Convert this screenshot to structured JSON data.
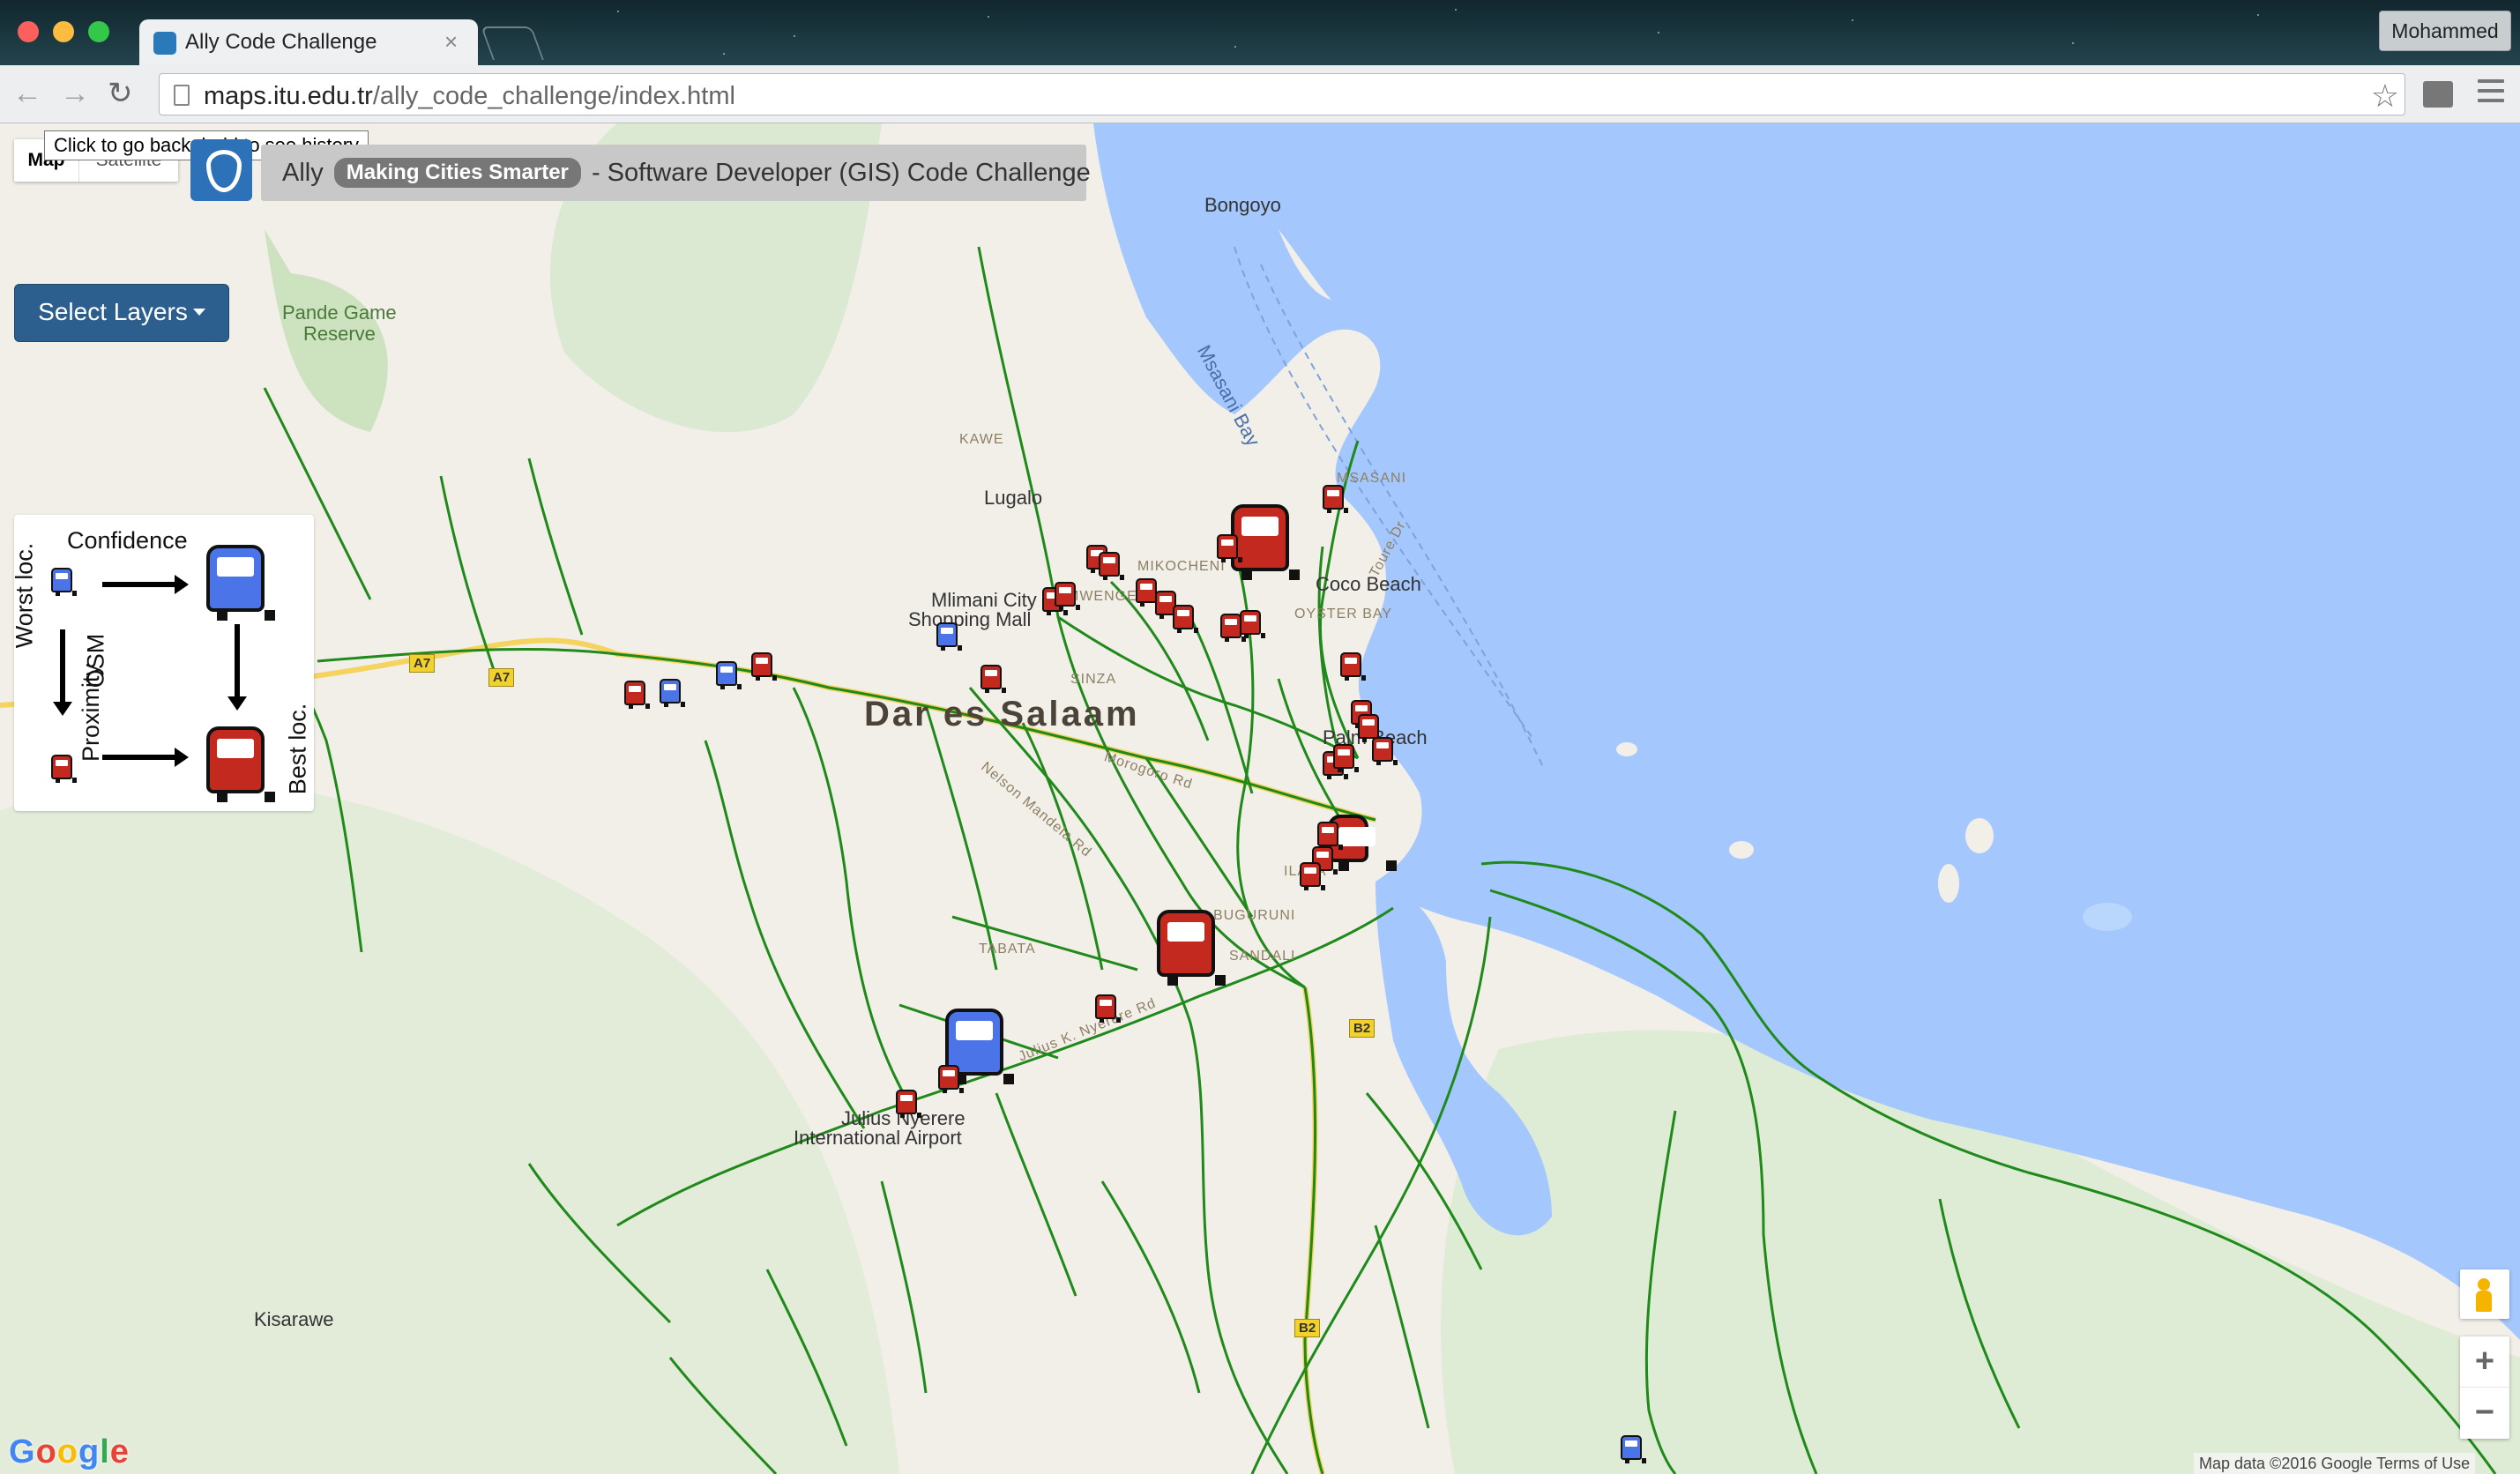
{
  "browser": {
    "tab_title": "Ally Code Challenge",
    "tab_close": "×",
    "url_host": "maps.itu.edu.tr",
    "url_path": "/ally_code_challenge/index.html",
    "profile": "Mohammed",
    "back": "←",
    "forward": "→",
    "reload": "↻",
    "bookmark": "☆"
  },
  "tooltip": "Click to go back, hold to see history",
  "map_type": {
    "map": "Map",
    "satellite": "Satellite"
  },
  "header": {
    "prefix": "Ally",
    "badge": "Making Cities Smarter",
    "suffix": "- Software Developer (GIS) Code Challenge"
  },
  "select_layers": "Select Layers",
  "legend": {
    "confidence": "Confidence",
    "worst": "Worst loc.",
    "best": "Best loc.",
    "osm": "OSM",
    "proximity": "Proximity"
  },
  "places": {
    "dar": "Dar es Salaam",
    "bongoyo": "Bongoyo",
    "msasani_bay": "Msasani Bay",
    "lugalo": "Lugalo",
    "mlimani": "Mlimani City",
    "shopping_mall": "Shopping Mall",
    "coco_beach": "Coco Beach",
    "palm_beach": "Palm Beach",
    "airport1": "Julius Nyerere",
    "airport2": "International Airport",
    "kisarawe": "Kisarawe",
    "pande": "Pande Game",
    "pande2": "Reserve",
    "kawe": "KAWE",
    "mikocheni": "MIKOCHENI",
    "msasani": "MSASANI",
    "oyster_bay": "OYSTER BAY",
    "sinza": "SINZA",
    "tabata": "TABATA",
    "sandali": "SANDALI",
    "ilala": "ILALA",
    "buguruni": "BUGURUNI",
    "mwenge": "MWENGE",
    "toure_dr": "Toure Dr",
    "morogoro_rd": "Morogoro Rd",
    "nelson_mandela": "Nelson Mandela Rd",
    "julius_nyerere_rd": "Julius K. Nyerere Rd"
  },
  "shields": {
    "a7": "A7",
    "b2": "B2"
  },
  "zoom": {
    "in": "+",
    "out": "−"
  },
  "google": {
    "g": "G",
    "o1": "o",
    "o2": "o",
    "g2": "g",
    "l": "l",
    "e": "e"
  },
  "attribution": "Map data ©2016 Google   Terms of Use",
  "colors": {
    "water": "#a4c8fd",
    "road": "#1f8a1a",
    "bus_red": "#c3291f",
    "bus_blue": "#4a74e8",
    "button": "#2c5f8e"
  }
}
